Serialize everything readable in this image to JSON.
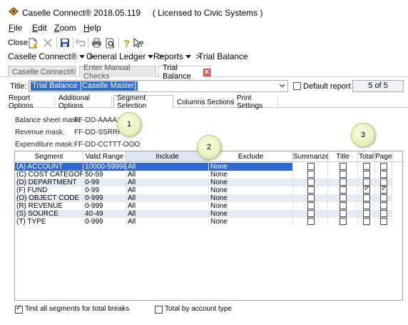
{
  "window": {
    "title": "Caselle Connect® 2018.05.119     ( Licensed to Civic Systems )"
  },
  "menu": [
    {
      "label": "File",
      "mnemonic": "F",
      "rest": "ile"
    },
    {
      "label": "Edit",
      "mnemonic": "E",
      "rest": "dit"
    },
    {
      "label": "Zoom",
      "mnemonic": "Z",
      "rest": "oom"
    },
    {
      "label": "Help",
      "mnemonic": "H",
      "rest": "elp"
    }
  ],
  "toolbar": {
    "close_label": "Close",
    "icons": [
      "new-doc-icon",
      "delete-icon",
      "save-icon",
      "undo-icon",
      "print-icon",
      "print-preview-icon",
      "help-icon",
      "whats-this-icon"
    ]
  },
  "breadcrumb": {
    "items": [
      "Caselle Connect®",
      "General Ledger",
      "Reports",
      "Trial Balance"
    ],
    "separator": ">"
  },
  "doc_tabs": [
    {
      "label": "Caselle Connect®",
      "active": false
    },
    {
      "label": "Enter Manual Checks",
      "active": false
    },
    {
      "label": "Trial Balance",
      "active": true
    }
  ],
  "report": {
    "title_label": "Title:",
    "title_value": "Trial Balance [Caselle Master]",
    "default_report_label": "Default report",
    "pager": "5 of 5"
  },
  "sub_tabs": [
    "Report Options",
    "Additional Options",
    "Segment Selection",
    "Columns",
    "Sections",
    "Print Settings"
  ],
  "active_sub_tab": "Segment Selection",
  "masks": [
    {
      "label": "Balance sheet mask:",
      "value": "FF-DD-AAAAA"
    },
    {
      "label": "Revenue mask:",
      "value": "FF-DD-SSRRR"
    },
    {
      "label": "Expenditure mask:",
      "value": "FF-DD-CCTTT-OOO"
    }
  ],
  "callouts": [
    "1",
    "2",
    "3"
  ],
  "grid": {
    "headers": [
      "Segment",
      "Valid Range",
      "Include",
      "Exclude",
      "Summarize",
      "Title",
      "Total",
      "Page"
    ],
    "rows": [
      {
        "segment": "(A) ACCOUNT",
        "range": "10000-59999",
        "include": "All",
        "exclude": "None",
        "summarize": false,
        "title": false,
        "total": false,
        "page": false,
        "selected": true
      },
      {
        "segment": "(C) COST CATEGORY",
        "range": "50-59",
        "include": "All",
        "exclude": "None",
        "summarize": false,
        "title": false,
        "total": false,
        "page": false,
        "selected": false
      },
      {
        "segment": "(D) DEPARTMENT",
        "range": "0-99",
        "include": "All",
        "exclude": "None",
        "summarize": false,
        "title": false,
        "total": false,
        "page": false,
        "selected": false
      },
      {
        "segment": "(F) FUND",
        "range": "0-99",
        "include": "All",
        "exclude": "None",
        "summarize": false,
        "title": false,
        "total": true,
        "page": true,
        "selected": false
      },
      {
        "segment": "(O) OBJECT CODE",
        "range": "0-999",
        "include": "All",
        "exclude": "None",
        "summarize": false,
        "title": false,
        "total": false,
        "page": false,
        "selected": false
      },
      {
        "segment": "(R) REVENUE",
        "range": "0-999",
        "include": "All",
        "exclude": "None",
        "summarize": false,
        "title": false,
        "total": false,
        "page": false,
        "selected": false
      },
      {
        "segment": "(S) SOURCE",
        "range": "40-49",
        "include": "All",
        "exclude": "None",
        "summarize": false,
        "title": false,
        "total": false,
        "page": false,
        "selected": false
      },
      {
        "segment": "(T) TYPE",
        "range": "0-999",
        "include": "All",
        "exclude": "None",
        "summarize": false,
        "title": false,
        "total": false,
        "page": false,
        "selected": false
      }
    ]
  },
  "footer": {
    "test_all_label": "Test all segments for total breaks",
    "test_all_checked": true,
    "total_by_type_label": "Total by account type",
    "total_by_type_checked": false
  },
  "colors": {
    "selection": "#2f68d1",
    "row_alt": "#e6ecf6",
    "callout_fill": "#eaf3c2",
    "close_tab": "#e46b6b"
  }
}
